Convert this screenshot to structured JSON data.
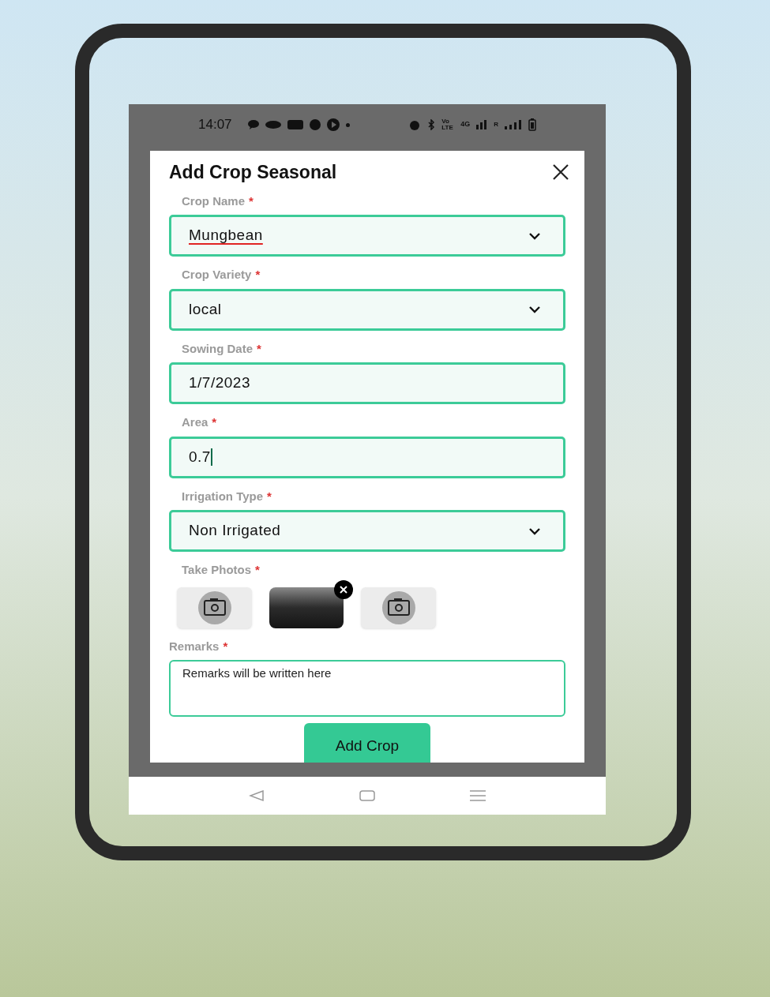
{
  "status_bar": {
    "time": "14:07",
    "volte": "Vo LTE",
    "network": "4G",
    "roaming": "R"
  },
  "dialog": {
    "title": "Add Crop Seasonal",
    "fields": [
      {
        "kind": "dropdown",
        "label": "Crop Name",
        "required_mark": "*",
        "value": "Mungbean",
        "spell_error": true
      },
      {
        "kind": "dropdown",
        "label": "Crop Variety",
        "required_mark": "*",
        "value": "local",
        "spell_error": false
      },
      {
        "kind": "text",
        "label": "Sowing Date",
        "required_mark": "*",
        "value": "1/7/2023",
        "spell_error": false
      },
      {
        "kind": "text",
        "label": "Area",
        "required_mark": "*",
        "value": "0.7",
        "spell_error": false,
        "focused": true
      },
      {
        "kind": "dropdown",
        "label": "Irrigation Type",
        "required_mark": "*",
        "value": "Non Irrigated",
        "spell_error": false
      }
    ],
    "photos": {
      "label": "Take Photos",
      "required_mark": "*",
      "items": [
        {
          "kind": "camera"
        },
        {
          "kind": "photo"
        },
        {
          "kind": "camera"
        }
      ]
    },
    "remarks": {
      "label": "Remarks",
      "required_mark": "*",
      "placeholder": "Remarks will be written here"
    },
    "submit": "Add Crop"
  }
}
